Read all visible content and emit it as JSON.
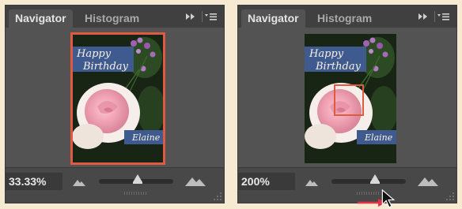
{
  "panels": [
    {
      "tabs": {
        "active": "Navigator",
        "inactive": "Histogram"
      },
      "card": {
        "greeting_line1": "Happy",
        "greeting_line2": "Birthday",
        "name": "Elaine"
      },
      "zoom": {
        "value": "33.33%",
        "slider_level": 0.52
      }
    },
    {
      "tabs": {
        "active": "Navigator",
        "inactive": "Histogram"
      },
      "card": {
        "greeting_line1": "Happy",
        "greeting_line2": "Birthday",
        "name": "Elaine"
      },
      "zoom": {
        "value": "200%",
        "slider_level": 0.58
      }
    }
  ],
  "icons": {
    "fast_forward": "double-chevron-right-icon",
    "menu": "panel-menu-icon",
    "zoom_out": "small-mountain-icon",
    "zoom_in": "large-mountain-icon",
    "cursor": "arrow-cursor-icon"
  },
  "colors": {
    "panel_bg": "#535353",
    "tab_bar": "#404040",
    "proxy_view_box": "#e05a40",
    "name_banner": "#3f5a8f"
  }
}
